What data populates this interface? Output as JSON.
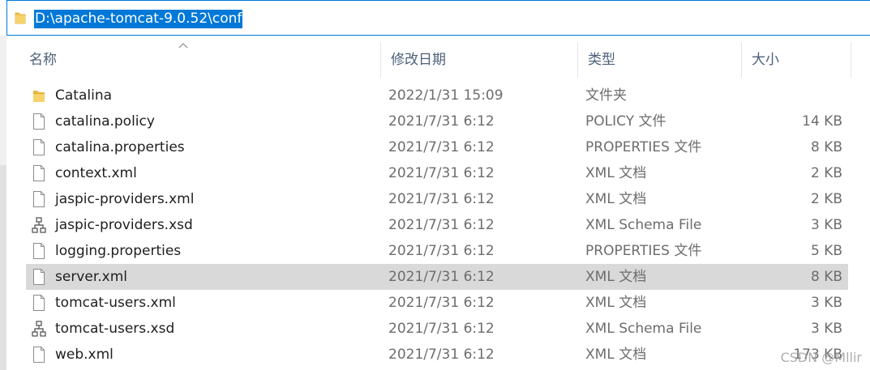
{
  "address": {
    "path": "D:\\apache-tomcat-9.0.52\\conf",
    "icon": "folder-icon"
  },
  "columns": {
    "name": "名称",
    "date": "修改日期",
    "type": "类型",
    "size": "大小"
  },
  "files": [
    {
      "name": "Catalina",
      "date": "2022/1/31 15:09",
      "type": "文件夹",
      "size": "",
      "icon": "folder-icon"
    },
    {
      "name": "catalina.policy",
      "date": "2021/7/31 6:12",
      "type": "POLICY 文件",
      "size": "14 KB",
      "icon": "file-icon"
    },
    {
      "name": "catalina.properties",
      "date": "2021/7/31 6:12",
      "type": "PROPERTIES 文件",
      "size": "8 KB",
      "icon": "file-icon"
    },
    {
      "name": "context.xml",
      "date": "2021/7/31 6:12",
      "type": "XML 文档",
      "size": "2 KB",
      "icon": "file-icon"
    },
    {
      "name": "jaspic-providers.xml",
      "date": "2021/7/31 6:12",
      "type": "XML 文档",
      "size": "2 KB",
      "icon": "file-icon"
    },
    {
      "name": "jaspic-providers.xsd",
      "date": "2021/7/31 6:12",
      "type": "XML Schema File",
      "size": "3 KB",
      "icon": "schema-icon"
    },
    {
      "name": "logging.properties",
      "date": "2021/7/31 6:12",
      "type": "PROPERTIES 文件",
      "size": "5 KB",
      "icon": "file-icon"
    },
    {
      "name": "server.xml",
      "date": "2021/7/31 6:12",
      "type": "XML 文档",
      "size": "8 KB",
      "icon": "file-icon",
      "selected": true
    },
    {
      "name": "tomcat-users.xml",
      "date": "2021/7/31 6:12",
      "type": "XML 文档",
      "size": "3 KB",
      "icon": "file-icon"
    },
    {
      "name": "tomcat-users.xsd",
      "date": "2021/7/31 6:12",
      "type": "XML Schema File",
      "size": "3 KB",
      "icon": "schema-icon"
    },
    {
      "name": "web.xml",
      "date": "2021/7/31 6:12",
      "type": "XML 文档",
      "size": "173 KB",
      "icon": "file-icon"
    }
  ],
  "watermark": "CSDN @Mllir",
  "colors": {
    "selection": "#0078d7",
    "row_highlight": "#d9d9d9",
    "folder": "#f0c14b"
  }
}
